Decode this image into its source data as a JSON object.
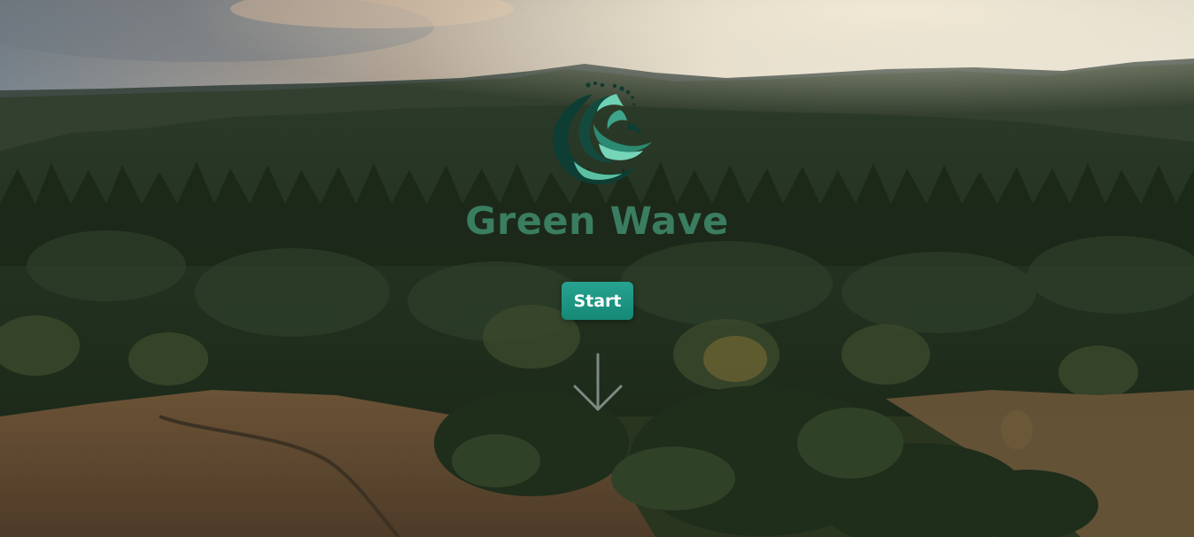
{
  "brand": {
    "title": "Green Wave",
    "logo_icon": "green-wave-logo-icon",
    "title_color": "#3a7d60"
  },
  "hero": {
    "background": "aerial-forest-landscape",
    "start_label": "Start",
    "start_color": "#1f9a86",
    "scroll_icon": "arrow-down-icon"
  }
}
